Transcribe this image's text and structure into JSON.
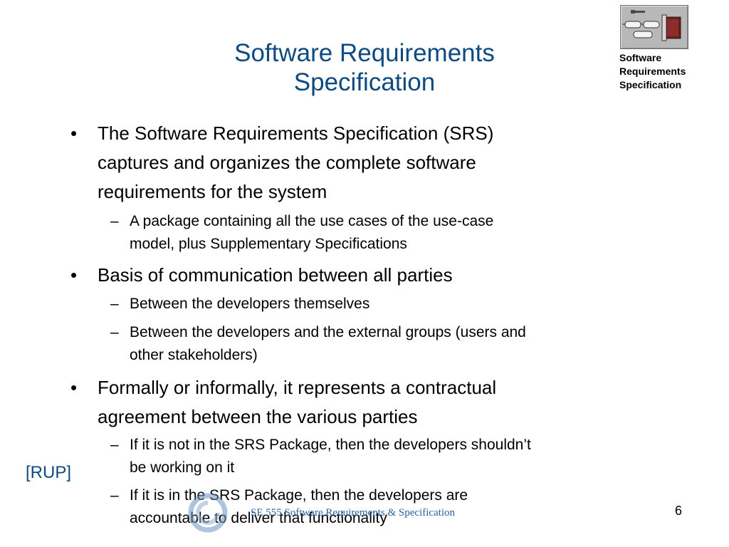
{
  "slide": {
    "title_line1": "Software Requirements",
    "title_line2": "Specification",
    "icon_label": [
      "Software",
      "Requirements",
      "Specification"
    ],
    "icon": "package-diagram-icon",
    "bullets": [
      {
        "lines": [
          "The Software Requirements Specification (SRS)",
          "captures and organizes the complete software",
          "requirements for the system"
        ],
        "subs": [
          {
            "lines": [
              "A package containing all the use cases of the use-case",
              "model, plus Supplementary Specifications"
            ]
          }
        ]
      },
      {
        "lines": [
          "Basis of communication between all parties"
        ],
        "subs": [
          {
            "lines": [
              "Between the developers themselves"
            ]
          },
          {
            "lines": [
              "Between the developers and the external groups (users and",
              "other stakeholders)"
            ]
          }
        ]
      },
      {
        "lines": [
          "Formally or informally, it represents a contractual",
          "agreement between the various parties"
        ],
        "subs": [
          {
            "lines": [
              "If it is not in the SRS Package, then the developers shouldn’t",
              "be working on it"
            ]
          },
          {
            "lines": [
              "If it is in the SRS Package, then the developers are",
              "accountable to deliver that functionality"
            ]
          }
        ]
      }
    ],
    "bullet_marker": "•",
    "sub_marker": "–",
    "side_note": "[RUP]",
    "footer": "SE 555 Software Requirements & Specification",
    "page_number": "6",
    "colors": {
      "title": "#0d4a82",
      "footer": "#2c5fa0"
    }
  }
}
